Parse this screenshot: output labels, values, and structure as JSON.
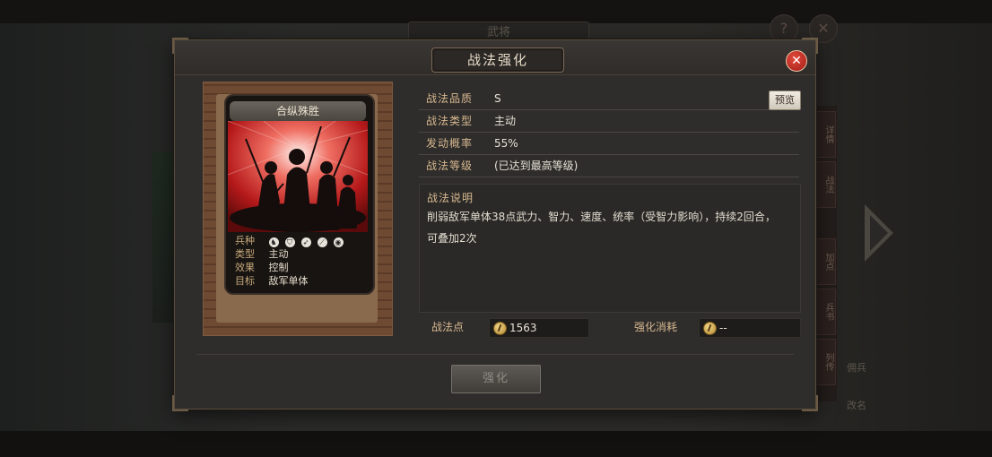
{
  "background": {
    "top_tab": "武将",
    "side_tabs": [
      "详情",
      "战法",
      "加点",
      "兵书",
      "列传"
    ],
    "bottom_right_1": "佣兵",
    "bottom_right_2": "改名"
  },
  "dialog": {
    "title": "战法强化",
    "close_label": "✕"
  },
  "card": {
    "name": "合纵殊胜",
    "labels": {
      "troop": "兵种",
      "type": "类型",
      "effect": "效果",
      "target": "目标"
    },
    "values": {
      "type": "主动",
      "effect": "控制",
      "target": "敌军单体"
    },
    "troop_icons": [
      "cavalry-icon",
      "shield-icon",
      "bow-icon",
      "spear-icon",
      "siege-icon"
    ]
  },
  "details": {
    "rows": [
      {
        "key": "战法品质",
        "value": "S"
      },
      {
        "key": "战法类型",
        "value": "主动"
      },
      {
        "key": "发动概率",
        "value": "55%"
      },
      {
        "key": "战法等级",
        "value": "(已达到最高等级)"
      }
    ],
    "preview_label": "预览"
  },
  "description": {
    "title": "战法说明",
    "text": "削弱敌军单体38点武力、智力、速度、统率（受智力影响），持续2回合，可叠加2次"
  },
  "points": {
    "owned_label": "战法点",
    "owned_value": "1563",
    "cost_label": "强化消耗",
    "cost_value": "--"
  },
  "actions": {
    "reinforce_label": "强化"
  },
  "colors": {
    "accent_gold": "#d8b890",
    "close_red": "#c2271d",
    "card_red": "#b5191a"
  }
}
